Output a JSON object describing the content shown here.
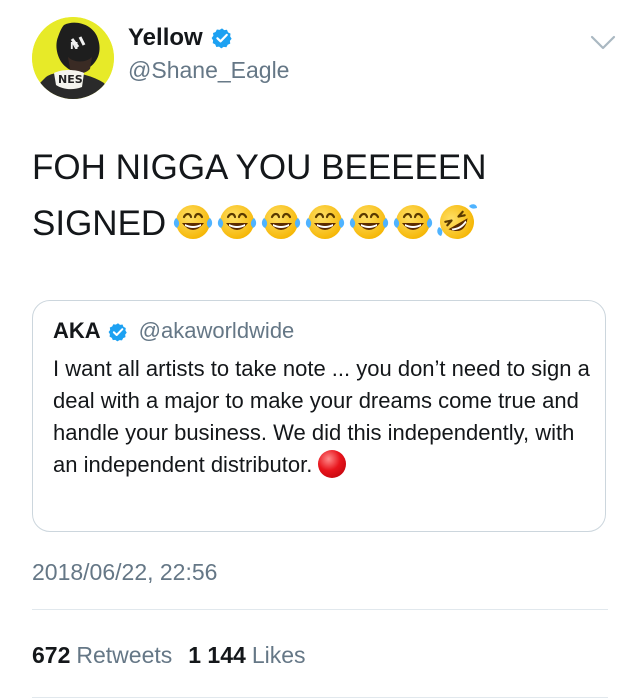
{
  "author": {
    "display_name": "Yellow",
    "handle": "@Shane_Eagle",
    "verified_icon": "verified-badge-icon",
    "caret_icon": "chevron-down-icon"
  },
  "tweet": {
    "text": "FOH NIGGA YOU BEEEEEN\nSIGNED",
    "emojis": [
      "face-with-tears-of-joy",
      "face-with-tears-of-joy",
      "face-with-tears-of-joy",
      "face-with-tears-of-joy",
      "face-with-tears-of-joy",
      "face-with-tears-of-joy",
      "rolling-on-floor-laughing"
    ]
  },
  "quoted_tweet": {
    "display_name": "AKA",
    "handle": "@akaworldwide",
    "text": "I want all artists to take note ... you don’t need to sign a deal with a major to make your dreams come true and handle your business. We did this independently, with an independent distributor.",
    "trailing_emoji": "large-red-circle"
  },
  "timestamp": "2018/06/22, 22:56",
  "stats": {
    "retweets_count": "672",
    "retweets_label": "Retweets",
    "likes_count": "1 144",
    "likes_label": "Likes"
  },
  "colors": {
    "text_primary": "#14171a",
    "text_secondary": "#657786",
    "verified_blue": "#1da1f2",
    "border": "#ccd6dd"
  }
}
